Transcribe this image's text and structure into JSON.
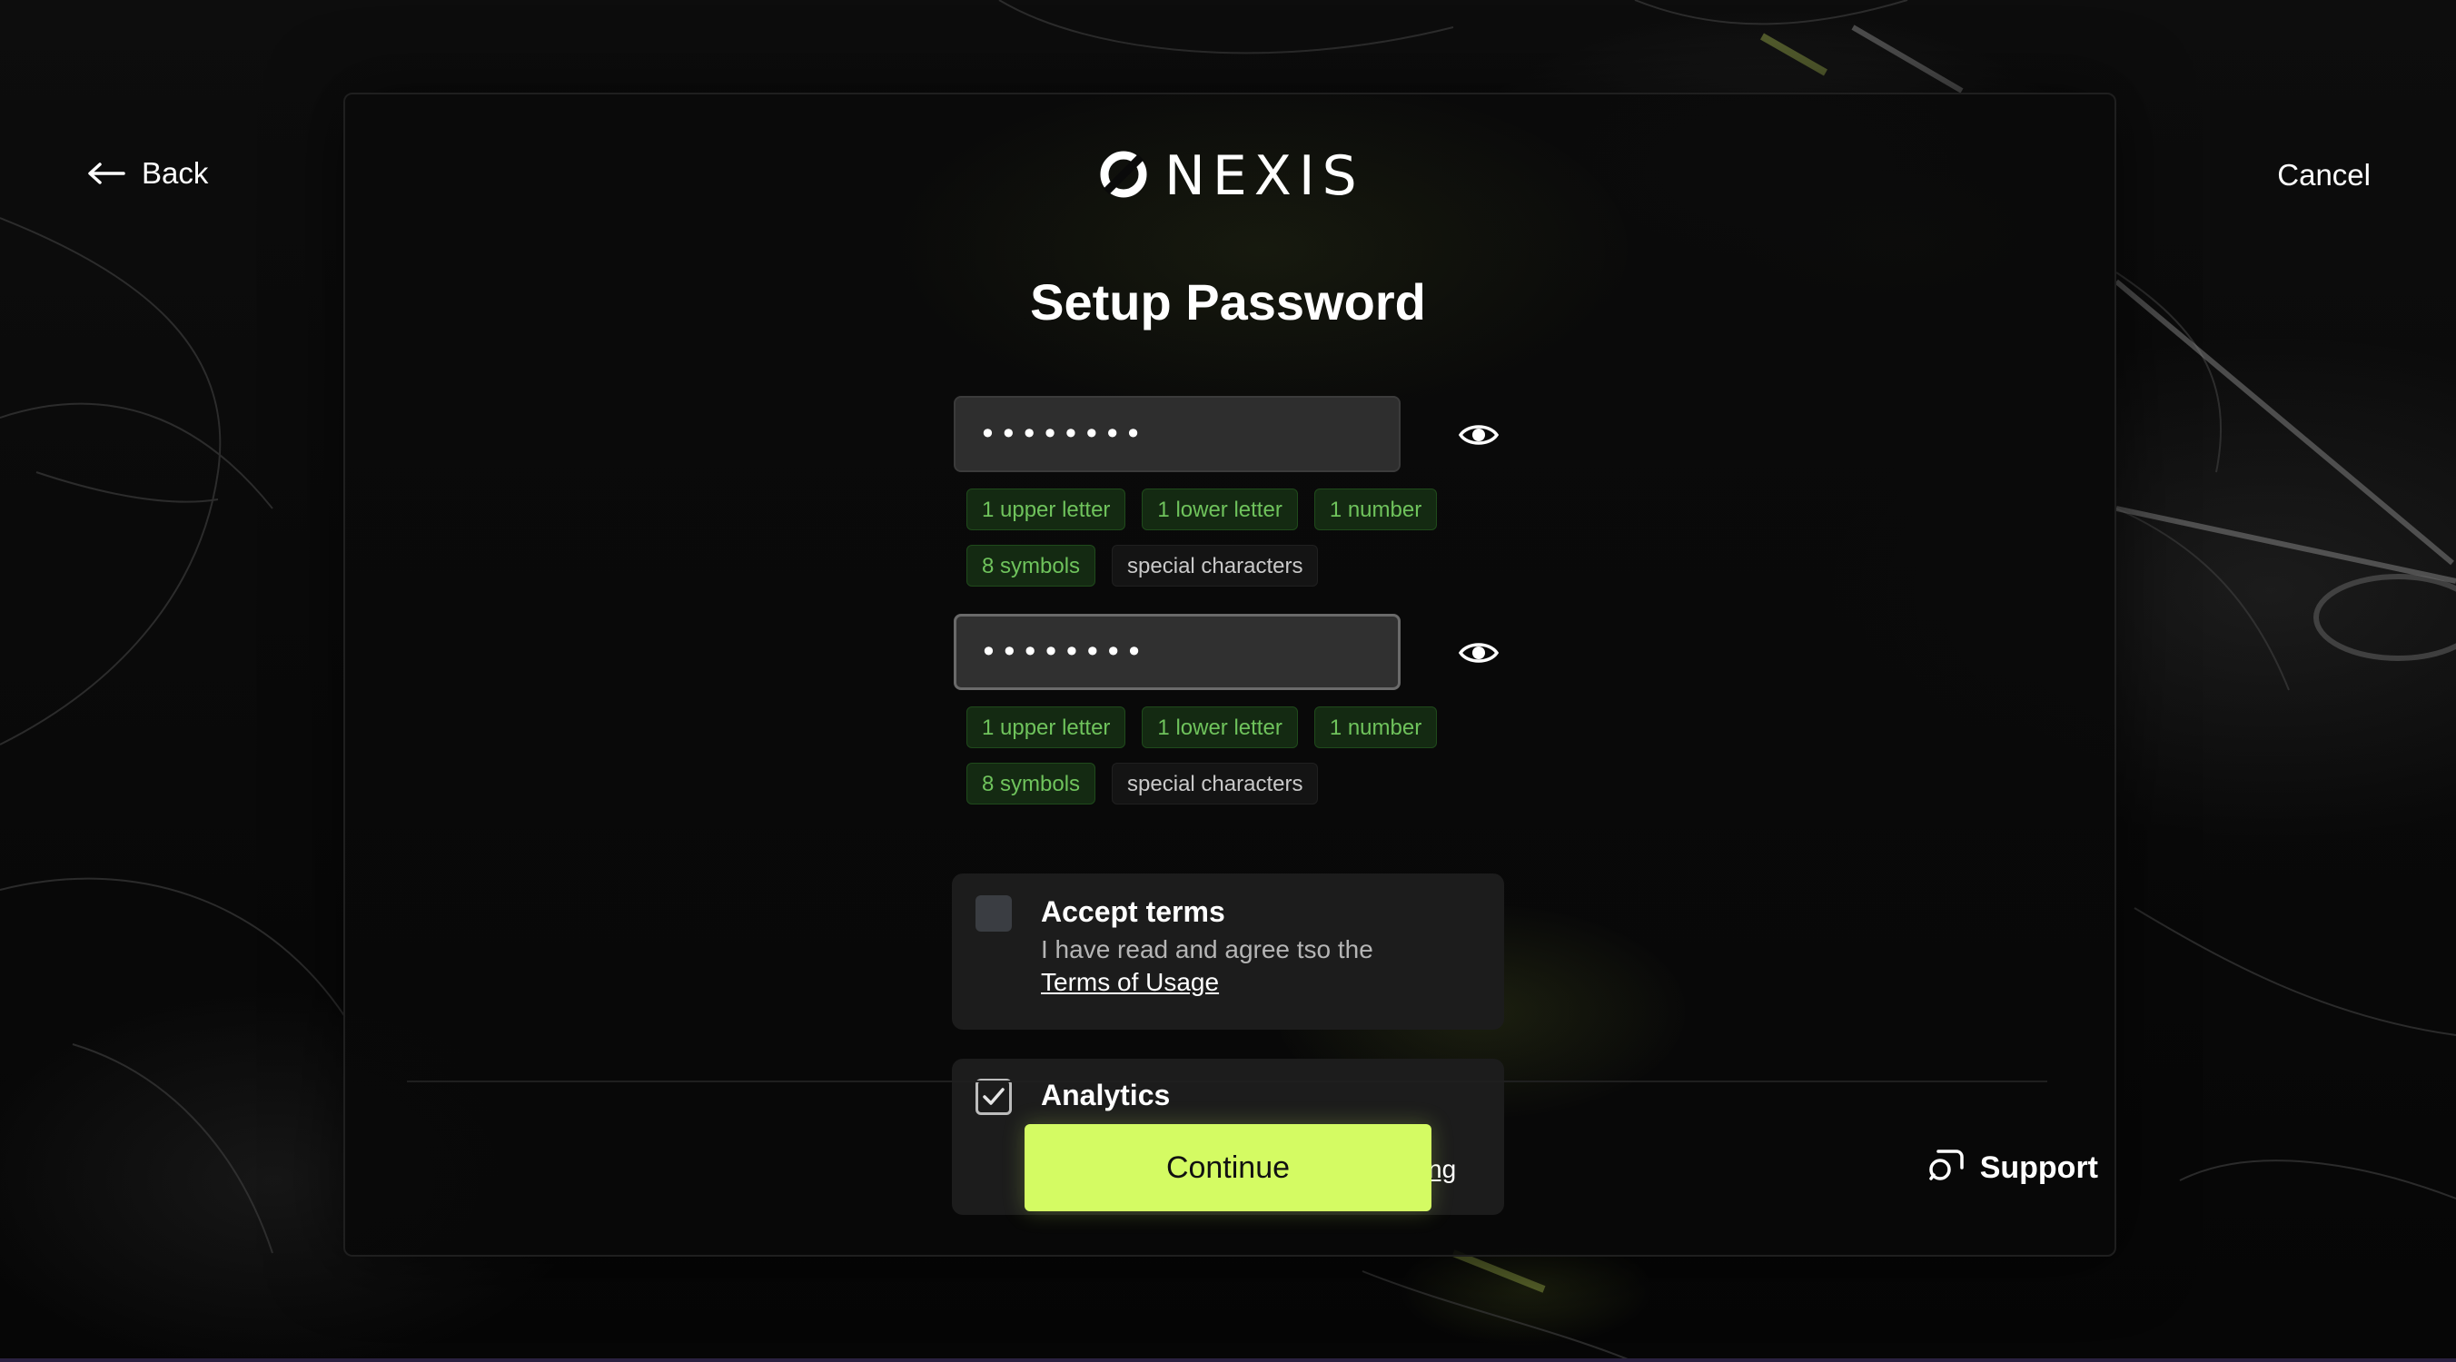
{
  "brand": {
    "name": "NEXIS",
    "accent": "#d4fb63"
  },
  "header": {
    "back_label": "Back",
    "cancel_label": "Cancel"
  },
  "title": "Setup Password",
  "password": {
    "value": "••••••••",
    "requirements": [
      {
        "label": "1 upper letter",
        "met": true
      },
      {
        "label": "1 lower letter",
        "met": true
      },
      {
        "label": "1 number",
        "met": true
      },
      {
        "label": "8 symbols",
        "met": true
      },
      {
        "label": "special characters",
        "met": false
      }
    ]
  },
  "confirm_password": {
    "value": "••••••••",
    "requirements": [
      {
        "label": "1 upper letter",
        "met": true
      },
      {
        "label": "1 lower letter",
        "met": true
      },
      {
        "label": "1 number",
        "met": true
      },
      {
        "label": "8 symbols",
        "met": true
      },
      {
        "label": "special characters",
        "met": false
      }
    ]
  },
  "terms": {
    "checked": false,
    "title": "Accept terms",
    "description": "I have read and agree tso the",
    "link": "Terms of Usage"
  },
  "analytics": {
    "checked": true,
    "title": "Analytics",
    "partial_link": "ng"
  },
  "footer": {
    "continue_label": "Continue",
    "support_label": "Support"
  },
  "icons": {
    "back": "arrow-left-icon",
    "logo": "nexis-logo-icon",
    "eye": "eye-icon",
    "check": "check-icon",
    "support": "chat-bubble-icon"
  }
}
